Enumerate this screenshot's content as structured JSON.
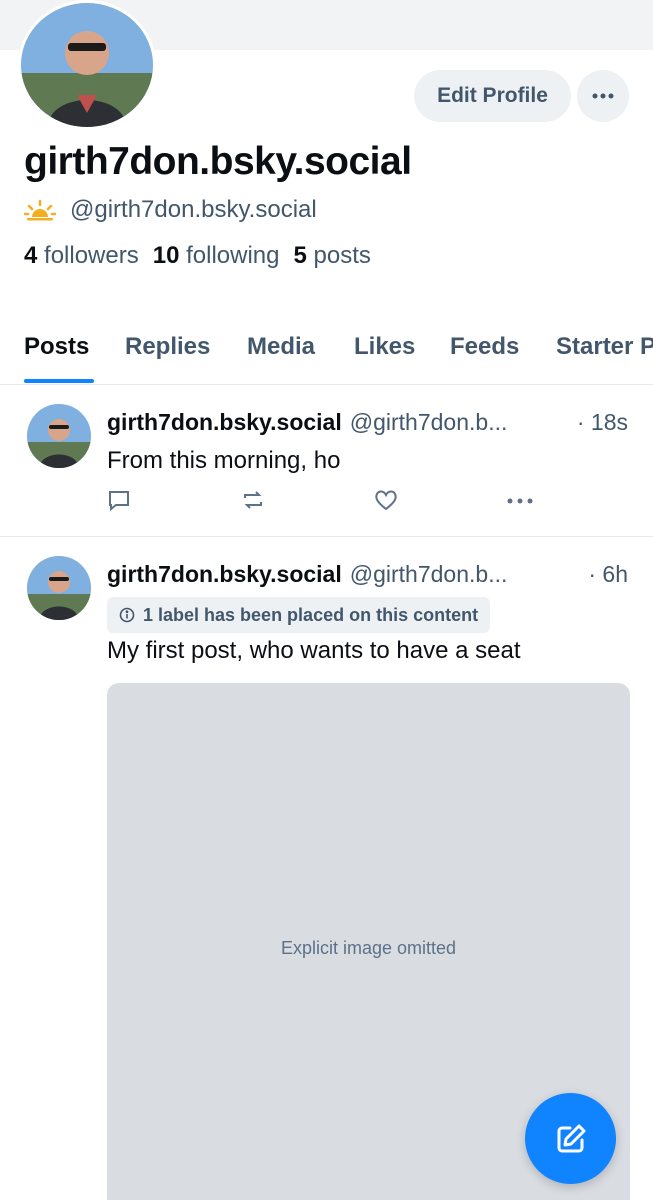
{
  "profile": {
    "display_name": "girth7don.bsky.social",
    "handle": "@girth7don.bsky.social",
    "handle_icon": "sun-icon",
    "stats": {
      "followers_count": "4",
      "followers_label": "followers",
      "following_count": "10",
      "following_label": "following",
      "posts_count": "5",
      "posts_label": "posts"
    },
    "edit_label": "Edit Profile"
  },
  "tabs": [
    "Posts",
    "Replies",
    "Media",
    "Likes",
    "Feeds",
    "Starter Packs"
  ],
  "active_tab": "Posts",
  "posts": [
    {
      "author": "girth7don.bsky.social",
      "handle": "@girth7don.b...",
      "time": "· 18s",
      "text": "From this morning, ho"
    },
    {
      "author": "girth7don.bsky.social",
      "handle": "@girth7don.b...",
      "time": "· 6h",
      "label": "1 label has been placed on this content",
      "text": "My first post, who wants to have a seat",
      "media_notice": "Explicit image omitted"
    }
  ],
  "colors": {
    "accent": "#1083fe",
    "muted": "#42576c",
    "chip_bg": "#eef1f4"
  }
}
